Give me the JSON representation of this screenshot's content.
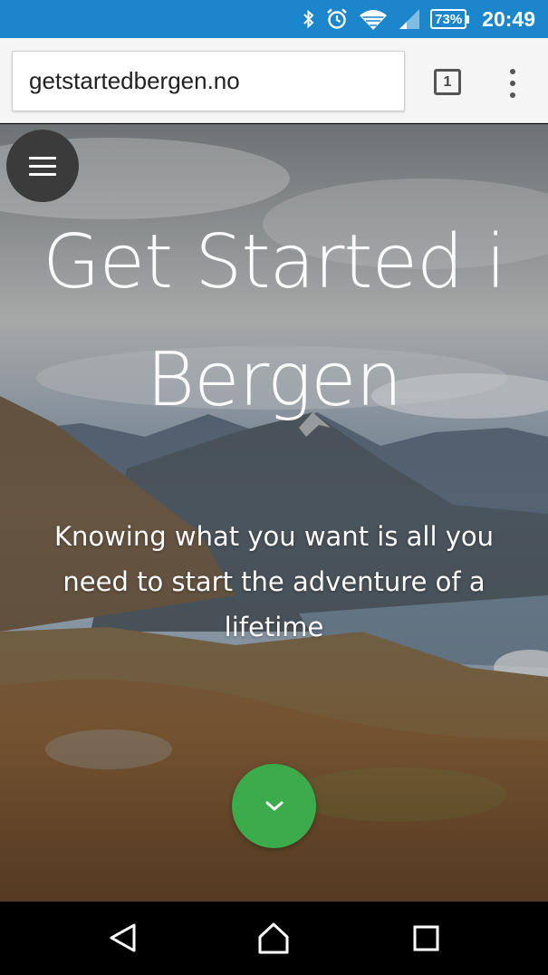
{
  "status_bar": {
    "icons": [
      "bluetooth-icon",
      "alarm-icon",
      "wifi-icon",
      "cell-signal-icon"
    ],
    "battery_level": "73%",
    "time": "20:49",
    "background_color": "#1b86cc"
  },
  "browser": {
    "url": "getstartedbergen.no",
    "tab_count": "1"
  },
  "hero": {
    "title": "Get Started i Bergen",
    "subtitle": "Knowing what you want is all you need to start the adventure of a lifetime",
    "menu_icon": "hamburger-menu-icon",
    "scroll_button_icon": "chevron-down-icon",
    "scroll_button_color": "#3bab4b"
  },
  "nav_bar": {
    "buttons": [
      "back-triangle-icon",
      "home-icon",
      "recents-square-icon"
    ]
  }
}
